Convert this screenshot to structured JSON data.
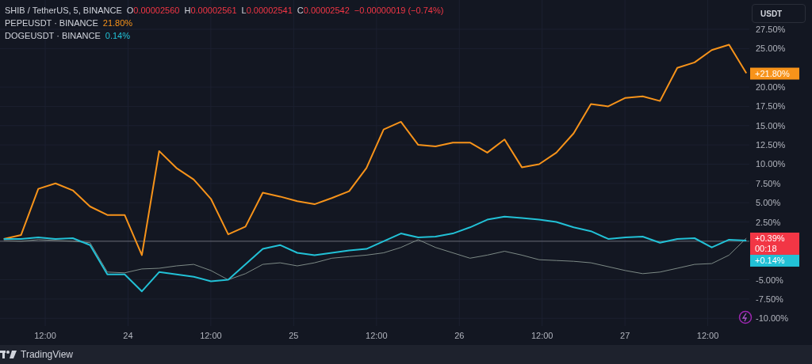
{
  "legend": {
    "main": {
      "symbol": "SHIB / TetherUS, 5, BINANCE",
      "fields": [
        {
          "label": "O",
          "value": "0.00002560"
        },
        {
          "label": "H",
          "value": "0.00002561"
        },
        {
          "label": "L",
          "value": "0.00002541"
        },
        {
          "label": "C",
          "value": "0.00002542"
        }
      ],
      "change": "−0.00000019 (−0.74%)"
    },
    "compare": [
      {
        "symbol": "PEPEUSDT · BINANCE",
        "value": "21.80%",
        "color": "#f7931a"
      },
      {
        "symbol": "DOGEUSDT · BINANCE",
        "value": "0.14%",
        "color": "#22c1d6"
      }
    ]
  },
  "currency_button": "USDT",
  "price_labels": [
    {
      "text": "+21.80%",
      "color": "#f7931a"
    },
    {
      "text": "+0.39%",
      "countdown": "00:18",
      "color": "#f23645"
    },
    {
      "text": "+0.14%",
      "color": "#22c1d6"
    }
  ],
  "chart_data": {
    "type": "line",
    "grid": true,
    "series": [
      {
        "color": "#f7931a",
        "values": [
          0.3,
          0.8,
          6.8,
          7.5,
          6.6,
          4.5,
          3.4,
          3.4,
          -1.8,
          11.7,
          9.5,
          8,
          5.5,
          0.9,
          1.9,
          6.3,
          5.8,
          5.2,
          4.8,
          5.6,
          6.5,
          9.5,
          14.5,
          15.5,
          12.5,
          12.3,
          12.8,
          12.8,
          11.5,
          13.2,
          9.6,
          10,
          11.5,
          14,
          17.8,
          17.5,
          18.6,
          18.8,
          18.2,
          22.5,
          23.2,
          24.8,
          25.5,
          21.8
        ]
      },
      {
        "color": "#7d8a86",
        "values": [
          0.1,
          0,
          0.2,
          0.1,
          0,
          -0.2,
          -4,
          -4.1,
          -3.6,
          -3.5,
          -3.2,
          -3,
          -3.8,
          -5,
          -4.2,
          -3,
          -2.8,
          -3.2,
          -2.8,
          -2.2,
          -2,
          -1.8,
          -1.5,
          -0.8,
          0.2,
          -0.8,
          -1.5,
          -2.2,
          -1.8,
          -1.3,
          -1.8,
          -2.4,
          -2.5,
          -2.6,
          -2.8,
          -3.3,
          -3.8,
          -4.2,
          -4,
          -3.5,
          -3,
          -2.9,
          -1.8,
          0.4
        ]
      },
      {
        "color": "#22c1d6",
        "values": [
          0.3,
          0.3,
          0.5,
          0.3,
          0.4,
          -0.5,
          -4.3,
          -4.3,
          -6.5,
          -4,
          -4.3,
          -4.6,
          -5.2,
          -5,
          -3,
          -1,
          -0.5,
          -1.5,
          -1.8,
          -1.5,
          -1.2,
          -1,
          0,
          1,
          0.5,
          0.6,
          1,
          1.8,
          2.8,
          3.2,
          3,
          2.8,
          2.5,
          1.8,
          1.3,
          0.3,
          0.5,
          0.6,
          -0.2,
          0.3,
          0.4,
          -0.8,
          0.2,
          0.1
        ]
      }
    ],
    "ylim": [
      -11,
      31.3
    ],
    "yticks": [
      {
        "value": 27.5,
        "label": "27.50%"
      },
      {
        "value": 25,
        "label": "25.00%"
      },
      {
        "value": 20,
        "label": "20.00%"
      },
      {
        "value": 17.5,
        "label": "17.50%"
      },
      {
        "value": 15,
        "label": "15.00%"
      },
      {
        "value": 12.5,
        "label": "12.50%"
      },
      {
        "value": 10,
        "label": "10.00%"
      },
      {
        "value": 7.5,
        "label": "7.50%"
      },
      {
        "value": 5,
        "label": "5.00%"
      },
      {
        "value": 2.5,
        "label": "2.50%"
      },
      {
        "value": -5,
        "label": "-5.00%"
      },
      {
        "value": -7.5,
        "label": "-7.50%"
      },
      {
        "value": -10,
        "label": "-10.00%"
      }
    ]
  },
  "time_labels": [
    "12:00",
    "24",
    "12:00",
    "25",
    "12:00",
    "26",
    "12:00",
    "27",
    "12:00"
  ],
  "footer": {
    "brand": "TradingView"
  }
}
